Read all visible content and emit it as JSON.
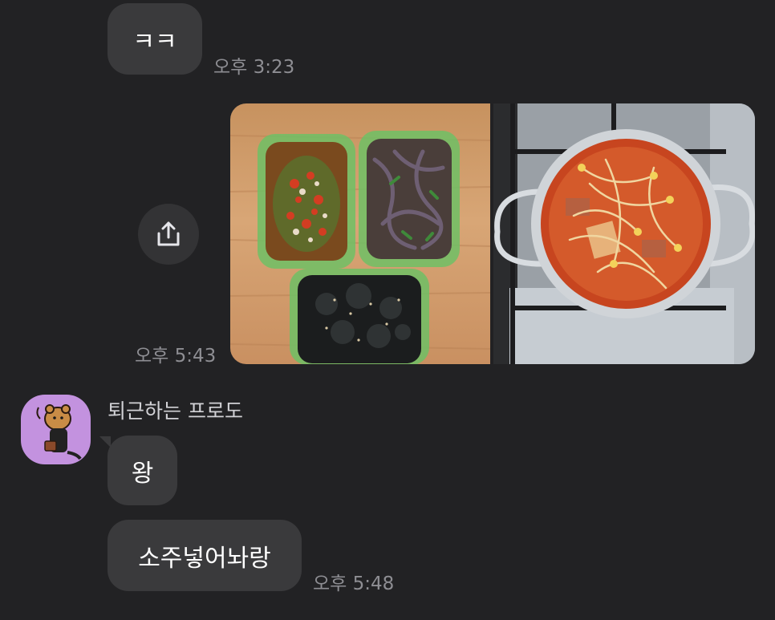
{
  "messages": {
    "kk": {
      "text": "ㅋㅋ",
      "time": "오후 3:23"
    },
    "photos": {
      "time": "오후 5:43"
    },
    "sender": {
      "name": "퇴근하는 프로도"
    },
    "wang": {
      "text": "왕"
    },
    "soju": {
      "text": "소주넣어놔랑",
      "time": "오후 5:48"
    }
  },
  "icons": {
    "share": "share-icon",
    "avatar": "frodo-avatar"
  },
  "colors": {
    "background": "#222224",
    "bubble": "#3a3a3c",
    "timestamp": "#8e8e93",
    "avatar_bg": "#c392df"
  }
}
